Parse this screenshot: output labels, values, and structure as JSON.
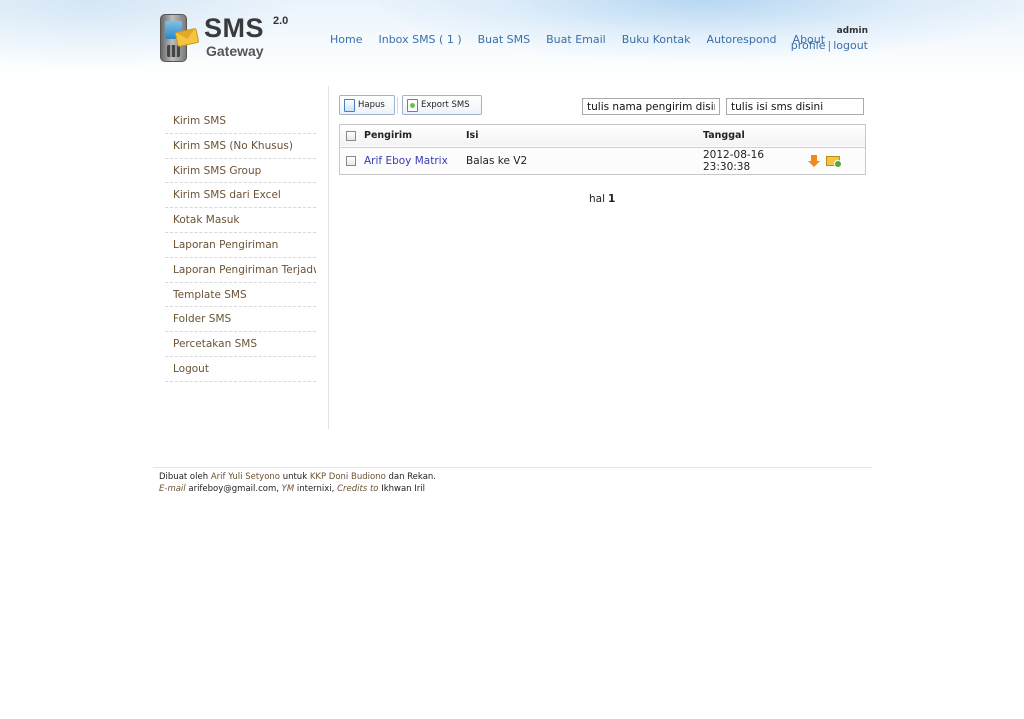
{
  "logo": {
    "brand": "SMS",
    "version": "2.0",
    "subtitle": "Gateway"
  },
  "nav": [
    {
      "label": "Home"
    },
    {
      "label": "Inbox SMS ( 1 )"
    },
    {
      "label": "Buat SMS"
    },
    {
      "label": "Buat Email"
    },
    {
      "label": "Buku Kontak"
    },
    {
      "label": "Autorespond"
    },
    {
      "label": "About"
    }
  ],
  "user": {
    "name": "admin",
    "profile": "profile",
    "separator": "|",
    "logout": "logout"
  },
  "sidebar": [
    {
      "label": "Kirim SMS"
    },
    {
      "label": "Kirim SMS (No Khusus)"
    },
    {
      "label": "Kirim SMS Group"
    },
    {
      "label": "Kirim SMS dari Excel"
    },
    {
      "label": "Kotak Masuk"
    },
    {
      "label": "Laporan Pengiriman"
    },
    {
      "label": "Laporan Pengiriman Terjadwal"
    },
    {
      "label": "Template SMS"
    },
    {
      "label": "Folder SMS"
    },
    {
      "label": "Percetakan SMS"
    },
    {
      "label": "Logout"
    }
  ],
  "toolbar": {
    "delete_label": "Hapus",
    "export_label": "Export SMS"
  },
  "search": {
    "sender_value": "tulis nama pengirim disini",
    "message_value": "tulis isi sms disini"
  },
  "table": {
    "headers": {
      "sender": "Pengirim",
      "message": "Isi",
      "date": "Tanggal"
    },
    "rows": [
      {
        "sender": "Arif Eboy Matrix",
        "message": "Balas ke V2",
        "date": "2012-08-16",
        "time": "23:30:38"
      }
    ]
  },
  "pagination": {
    "label": "hal",
    "current": "1"
  },
  "footer": {
    "line1_prefix": "Dibuat oleh",
    "author": "Arif Yuli Setyono",
    "line1_mid": "untuk",
    "client": "KKP Doni Budiono",
    "line1_suffix": "dan Rekan.",
    "email_label": "E-mail",
    "email": "arifeboy@gmail.com,",
    "ym_label": "YM",
    "ym": "internixi,",
    "credits_label": "Credits to",
    "credits": "Ikhwan Iril"
  }
}
